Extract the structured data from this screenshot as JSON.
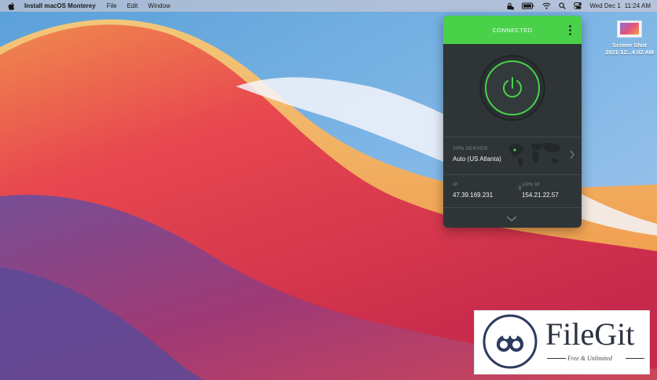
{
  "menubar": {
    "app_name": "Install macOS Monterey",
    "menus": [
      "File",
      "Edit",
      "Window"
    ],
    "clock_day": "Wed Dec 1",
    "clock_time": "11:24 AM",
    "icons": [
      "apple-icon",
      "vpn-status-icon",
      "battery-icon",
      "wifi-icon",
      "spotlight-icon",
      "control-center-icon"
    ]
  },
  "desktop": {
    "file_label_line1": "Screen Shot",
    "file_label_line2": "2021-12...4.02 AM"
  },
  "vpn": {
    "status": "CONNECTED",
    "server_label": "VPN SERVER",
    "server_value": "Auto (US Atlanta)",
    "ip_label": "IP",
    "ip_value": "47.39.169.231",
    "vpn_ip_label": "VPN IP",
    "vpn_ip_value": "154.21.22.57",
    "colors": {
      "accent": "#4ad14a",
      "panel": "#2f3537"
    }
  },
  "watermark": {
    "title": "FileGit",
    "tagline": "Free & Unlimited"
  }
}
